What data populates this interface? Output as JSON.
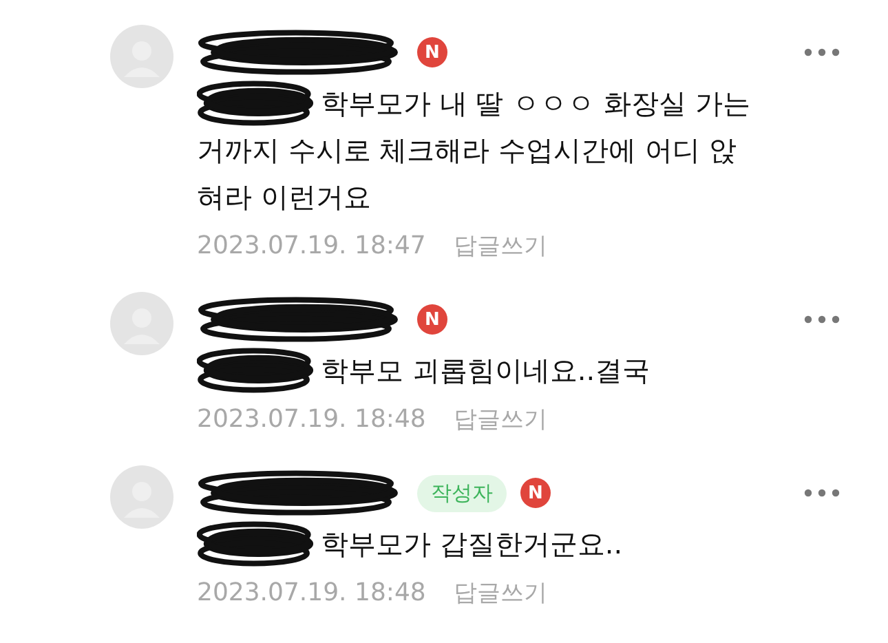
{
  "comments": [
    {
      "new_badge": "N",
      "body_lines": [
        "학부모가 내 딸 ㅇㅇㅇ 화장실 가는",
        "거까지 수시로 체크해라 수업시간에 어디 앉",
        "혀라 이런거요"
      ],
      "date": "2023.07.19. 18:47",
      "reply": "답글쓰기"
    },
    {
      "new_badge": "N",
      "body_lines": [
        "학부모 괴롭힘이네요..결국"
      ],
      "date": "2023.07.19. 18:48",
      "reply": "답글쓰기"
    },
    {
      "author_label": "작성자",
      "new_badge": "N",
      "body_lines": [
        "학부모가 갑질한거군요.."
      ],
      "date": "2023.07.19. 18:48",
      "reply": "답글쓰기"
    }
  ]
}
